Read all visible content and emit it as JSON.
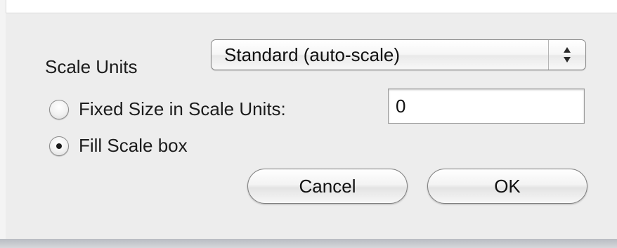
{
  "scale_units": {
    "label": "Scale Units",
    "selected": "Standard (auto-scale)"
  },
  "size_mode": {
    "fixed": {
      "label": "Fixed Size in Scale Units:",
      "checked": false
    },
    "fill": {
      "label": "Fill Scale box",
      "checked": true
    }
  },
  "fixed_size_value": "0",
  "buttons": {
    "cancel": "Cancel",
    "ok": "OK"
  },
  "icons": {
    "popup_arrows": "up-down-arrows-icon"
  }
}
